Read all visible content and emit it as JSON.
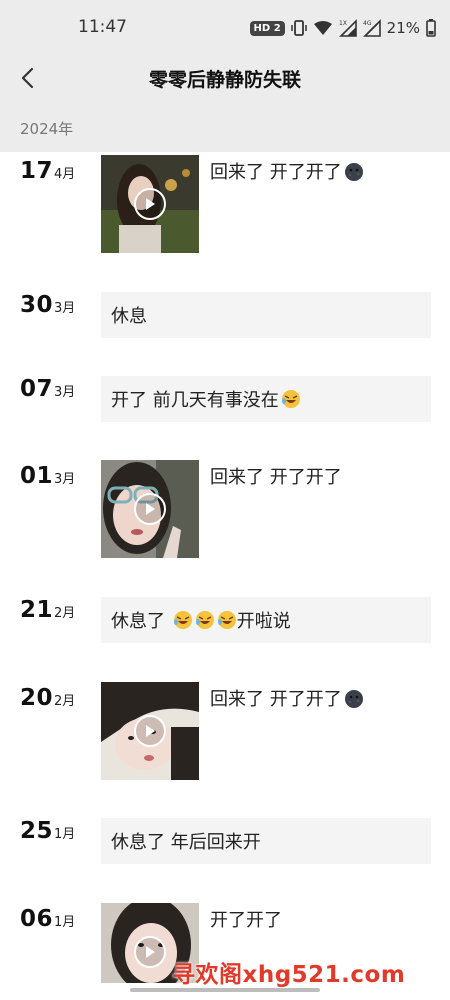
{
  "status_bar": {
    "time": "11:47",
    "hd_badge": "HD 2",
    "battery": "21%"
  },
  "header": {
    "title": "零零后静静防失联"
  },
  "year_label": "2024年",
  "entries": [
    {
      "day": "17",
      "month": "4月",
      "type": "video",
      "text": "回来了 开了开了",
      "emojis": [
        "moon-face-emoji"
      ]
    },
    {
      "day": "30",
      "month": "3月",
      "type": "text",
      "text": "休息",
      "emojis": []
    },
    {
      "day": "07",
      "month": "3月",
      "type": "text",
      "text": "开了 前几天有事没在",
      "emojis": [
        "laugh-cry-emoji"
      ]
    },
    {
      "day": "01",
      "month": "3月",
      "type": "video",
      "text": "回来了 开了开了",
      "emojis": []
    },
    {
      "day": "21",
      "month": "2月",
      "type": "text",
      "text_before": "休息了 ",
      "text_after": "开啦说",
      "emojis": [
        "laugh-cry-emoji",
        "laugh-cry-emoji",
        "laugh-cry-emoji"
      ]
    },
    {
      "day": "20",
      "month": "2月",
      "type": "video",
      "text": "回来了 开了开了",
      "emojis": [
        "moon-face-emoji"
      ]
    },
    {
      "day": "25",
      "month": "1月",
      "type": "text",
      "text": "休息了 年后回来开",
      "emojis": []
    },
    {
      "day": "06",
      "month": "1月",
      "type": "video",
      "text": "开了开了",
      "emojis": []
    }
  ],
  "watermark": "寻欢阁xhg521.com",
  "colors": {
    "header_bg": "#ececec",
    "card_bg": "#f4f4f4",
    "watermark": "#e23a2a"
  }
}
